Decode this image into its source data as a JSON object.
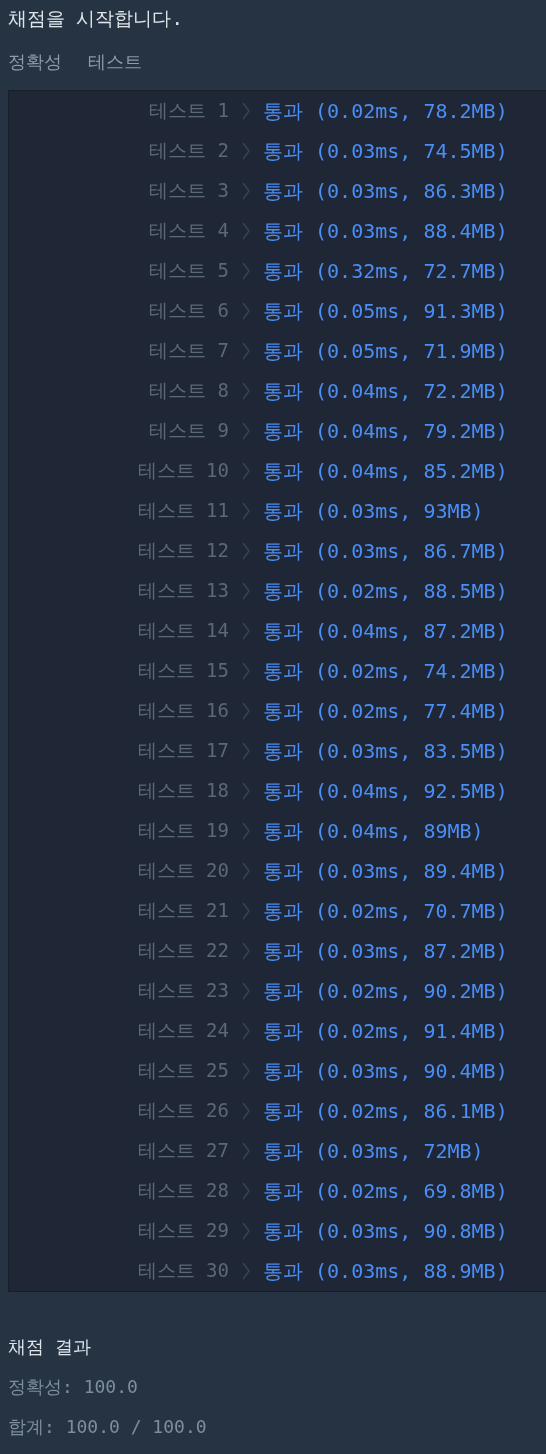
{
  "heading": "채점을 시작합니다.",
  "columns": [
    "정확성",
    "테스트"
  ],
  "tests": [
    {
      "label": "테스트 1",
      "result": "통과 (0.02ms, 78.2MB)"
    },
    {
      "label": "테스트 2",
      "result": "통과 (0.03ms, 74.5MB)"
    },
    {
      "label": "테스트 3",
      "result": "통과 (0.03ms, 86.3MB)"
    },
    {
      "label": "테스트 4",
      "result": "통과 (0.03ms, 88.4MB)"
    },
    {
      "label": "테스트 5",
      "result": "통과 (0.32ms, 72.7MB)"
    },
    {
      "label": "테스트 6",
      "result": "통과 (0.05ms, 91.3MB)"
    },
    {
      "label": "테스트 7",
      "result": "통과 (0.05ms, 71.9MB)"
    },
    {
      "label": "테스트 8",
      "result": "통과 (0.04ms, 72.2MB)"
    },
    {
      "label": "테스트 9",
      "result": "통과 (0.04ms, 79.2MB)"
    },
    {
      "label": "테스트 10",
      "result": "통과 (0.04ms, 85.2MB)"
    },
    {
      "label": "테스트 11",
      "result": "통과 (0.03ms, 93MB)"
    },
    {
      "label": "테스트 12",
      "result": "통과 (0.03ms, 86.7MB)"
    },
    {
      "label": "테스트 13",
      "result": "통과 (0.02ms, 88.5MB)"
    },
    {
      "label": "테스트 14",
      "result": "통과 (0.04ms, 87.2MB)"
    },
    {
      "label": "테스트 15",
      "result": "통과 (0.02ms, 74.2MB)"
    },
    {
      "label": "테스트 16",
      "result": "통과 (0.02ms, 77.4MB)"
    },
    {
      "label": "테스트 17",
      "result": "통과 (0.03ms, 83.5MB)"
    },
    {
      "label": "테스트 18",
      "result": "통과 (0.04ms, 92.5MB)"
    },
    {
      "label": "테스트 19",
      "result": "통과 (0.04ms, 89MB)"
    },
    {
      "label": "테스트 20",
      "result": "통과 (0.03ms, 89.4MB)"
    },
    {
      "label": "테스트 21",
      "result": "통과 (0.02ms, 70.7MB)"
    },
    {
      "label": "테스트 22",
      "result": "통과 (0.03ms, 87.2MB)"
    },
    {
      "label": "테스트 23",
      "result": "통과 (0.02ms, 90.2MB)"
    },
    {
      "label": "테스트 24",
      "result": "통과 (0.02ms, 91.4MB)"
    },
    {
      "label": "테스트 25",
      "result": "통과 (0.03ms, 90.4MB)"
    },
    {
      "label": "테스트 26",
      "result": "통과 (0.02ms, 86.1MB)"
    },
    {
      "label": "테스트 27",
      "result": "통과 (0.03ms, 72MB)"
    },
    {
      "label": "테스트 28",
      "result": "통과 (0.02ms, 69.8MB)"
    },
    {
      "label": "테스트 29",
      "result": "통과 (0.03ms, 90.8MB)"
    },
    {
      "label": "테스트 30",
      "result": "통과 (0.03ms, 88.9MB)"
    }
  ],
  "summary": {
    "title": "채점 결과",
    "lines": [
      "정확성: 100.0",
      "합계: 100.0 / 100.0"
    ]
  }
}
